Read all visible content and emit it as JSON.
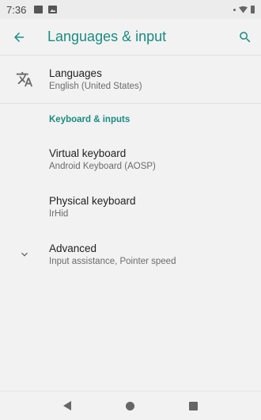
{
  "status_bar": {
    "time": "7:36",
    "icons": [
      "notification-icon",
      "image-icon",
      "wifi-icon",
      "battery-icon"
    ]
  },
  "app_bar": {
    "title": "Languages & input",
    "back_icon": "arrow-back-icon",
    "search_icon": "search-icon",
    "accent_color": "#1a8c80"
  },
  "languages": {
    "title": "Languages",
    "subtitle": "English (United States)",
    "icon": "translate-icon"
  },
  "keyboard_section": {
    "header": "Keyboard & inputs",
    "items": [
      {
        "title": "Virtual keyboard",
        "subtitle": "Android Keyboard (AOSP)"
      },
      {
        "title": "Physical keyboard",
        "subtitle": "IrHid"
      }
    ]
  },
  "advanced": {
    "title": "Advanced",
    "subtitle": "Input assistance, Pointer speed",
    "icon": "chevron-down-icon"
  },
  "nav_bar": {
    "buttons": [
      "nav-back-icon",
      "nav-home-icon",
      "nav-recents-icon"
    ]
  }
}
